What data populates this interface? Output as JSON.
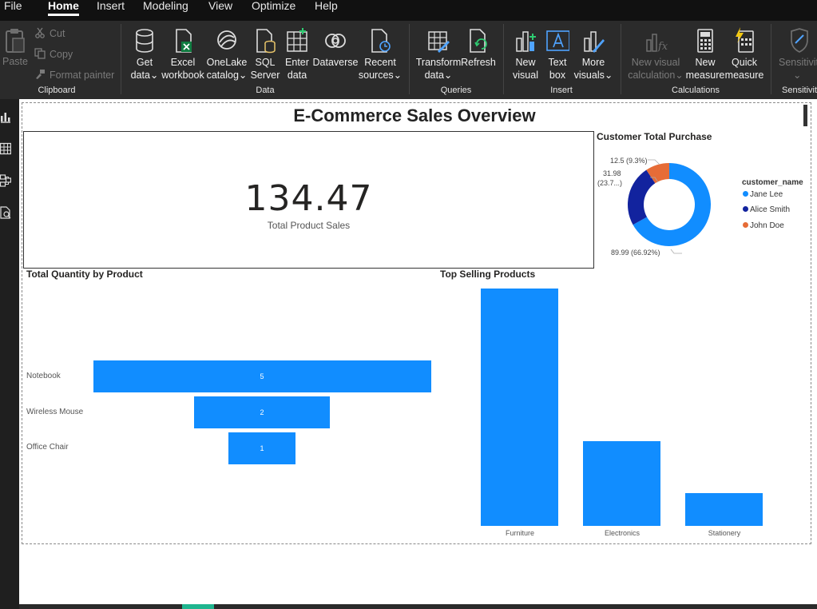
{
  "menu": [
    "File",
    "Home",
    "Insert",
    "Modeling",
    "View",
    "Optimize",
    "Help"
  ],
  "ribbon": {
    "clipboard": {
      "paste": "Paste",
      "cut": "Cut",
      "copy": "Copy",
      "format_painter": "Format painter",
      "group": "Clipboard"
    },
    "data": {
      "buttons": [
        {
          "l1": "Get",
          "l2": "data⌄"
        },
        {
          "l1": "Excel",
          "l2": "workbook"
        },
        {
          "l1": "OneLake",
          "l2": "catalog⌄"
        },
        {
          "l1": "SQL",
          "l2": "Server"
        },
        {
          "l1": "Enter",
          "l2": "data"
        },
        {
          "l1": "Dataverse",
          "l2": ""
        },
        {
          "l1": "Recent",
          "l2": "sources⌄"
        }
      ],
      "group": "Data"
    },
    "queries": {
      "transform_l1": "Transform",
      "transform_l2": "data⌄",
      "refresh": "Refresh",
      "group": "Queries"
    },
    "insert": {
      "new_visual_l1": "New",
      "new_visual_l2": "visual",
      "text_box_l1": "Text",
      "text_box_l2": "box",
      "more_visuals_l1": "More",
      "more_visuals_l2": "visuals⌄",
      "group": "Insert"
    },
    "calculations": {
      "new_visual_calc_l1": "New visual",
      "new_visual_calc_l2": "calculation⌄",
      "new_measure_l1": "New",
      "new_measure_l2": "measure",
      "quick_measure_l1": "Quick",
      "quick_measure_l2": "measure",
      "group": "Calculations"
    },
    "sensitivity": {
      "label": "Sensitivit",
      "chevron": "⌄",
      "group": "Sensitivity"
    }
  },
  "report": {
    "title": "E-Commerce Sales Overview",
    "card": {
      "value": "134.47",
      "label": "Total Product Sales"
    },
    "donut_title": "Customer Total Purchase",
    "funnel_title": "Total Quantity by Product",
    "column_title": "Top Selling Products",
    "donut_labels": {
      "john": "12.5 (9.3%)",
      "alice_l1": "31.98",
      "alice_l2": "(23.7...)",
      "jane": "89.99 (66.92%)"
    },
    "legend_title": "customer_name"
  },
  "colors": {
    "jane": "#118DFF",
    "alice": "#12239E",
    "john": "#E66C37",
    "bar": "#118DFF"
  },
  "chart_data": [
    {
      "type": "pie",
      "title": "Customer Total Purchase",
      "legend_title": "customer_name",
      "categories": [
        "Jane Lee",
        "Alice Smith",
        "John Doe"
      ],
      "values": [
        89.99,
        31.98,
        12.5
      ],
      "legend": "right"
    },
    {
      "type": "bar",
      "title": "Total Quantity by Product",
      "categories": [
        "Notebook",
        "Wireless Mouse",
        "Office Chair"
      ],
      "values": [
        5,
        2,
        1
      ]
    },
    {
      "type": "bar",
      "title": "Top Selling Products",
      "categories": [
        "Furniture",
        "Electronics",
        "Stationery"
      ],
      "values": [
        89.99,
        31.98,
        12.5
      ]
    }
  ]
}
